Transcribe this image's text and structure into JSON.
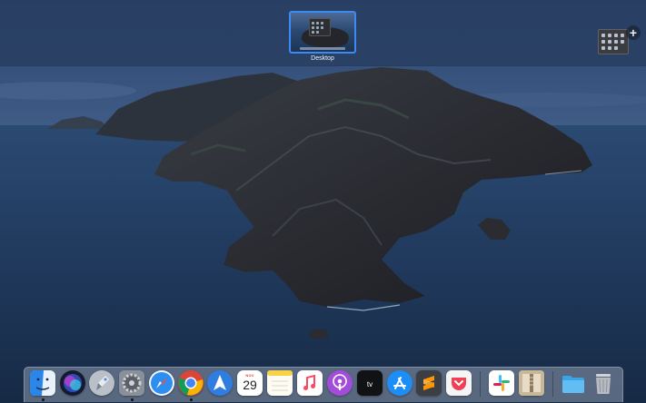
{
  "screen": "Mission Control",
  "spaces": {
    "items": [
      {
        "label": "Desktop",
        "selected": true
      }
    ],
    "add_space_symbol": "+"
  },
  "wallpaper": {
    "name": "Catalina island (night)",
    "icon": "wallpaper-island"
  },
  "calendar": {
    "month": "NOV",
    "day": "29"
  },
  "dock": {
    "apps": [
      {
        "name": "Finder",
        "icon": "finder-icon",
        "running": true
      },
      {
        "name": "Siri",
        "icon": "siri-icon",
        "running": false
      },
      {
        "name": "Launchpad",
        "icon": "launchpad-icon",
        "running": false
      },
      {
        "name": "System Preferences",
        "icon": "gear-icon",
        "running": true
      },
      {
        "name": "Safari",
        "icon": "safari-icon",
        "running": false
      },
      {
        "name": "Google Chrome",
        "icon": "chrome-icon",
        "running": true
      },
      {
        "name": "Spark",
        "icon": "paper-plane-icon",
        "running": false
      },
      {
        "name": "Calendar",
        "icon": "calendar-icon",
        "running": false
      },
      {
        "name": "Notes",
        "icon": "notes-icon",
        "running": false
      },
      {
        "name": "Music",
        "icon": "music-icon",
        "running": false
      },
      {
        "name": "Podcasts",
        "icon": "podcasts-icon",
        "running": false
      },
      {
        "name": "TV",
        "icon": "tv-icon",
        "running": false
      },
      {
        "name": "App Store",
        "icon": "app-store-icon",
        "running": false
      },
      {
        "name": "Sublime Text",
        "icon": "sublime-icon",
        "running": false
      },
      {
        "name": "Pocket",
        "icon": "pocket-icon",
        "running": false
      },
      {
        "name": "Slack",
        "icon": "slack-icon",
        "running": false
      },
      {
        "name": "Archive Utility",
        "icon": "archive-icon",
        "running": false
      },
      {
        "name": "Downloads",
        "icon": "folder-icon",
        "running": false
      },
      {
        "name": "Trash",
        "icon": "trash-icon",
        "running": false
      }
    ]
  },
  "colors": {
    "selection_border": "#3d8af7",
    "spaces_bar": "#283e60",
    "sea": "#1f3756"
  }
}
